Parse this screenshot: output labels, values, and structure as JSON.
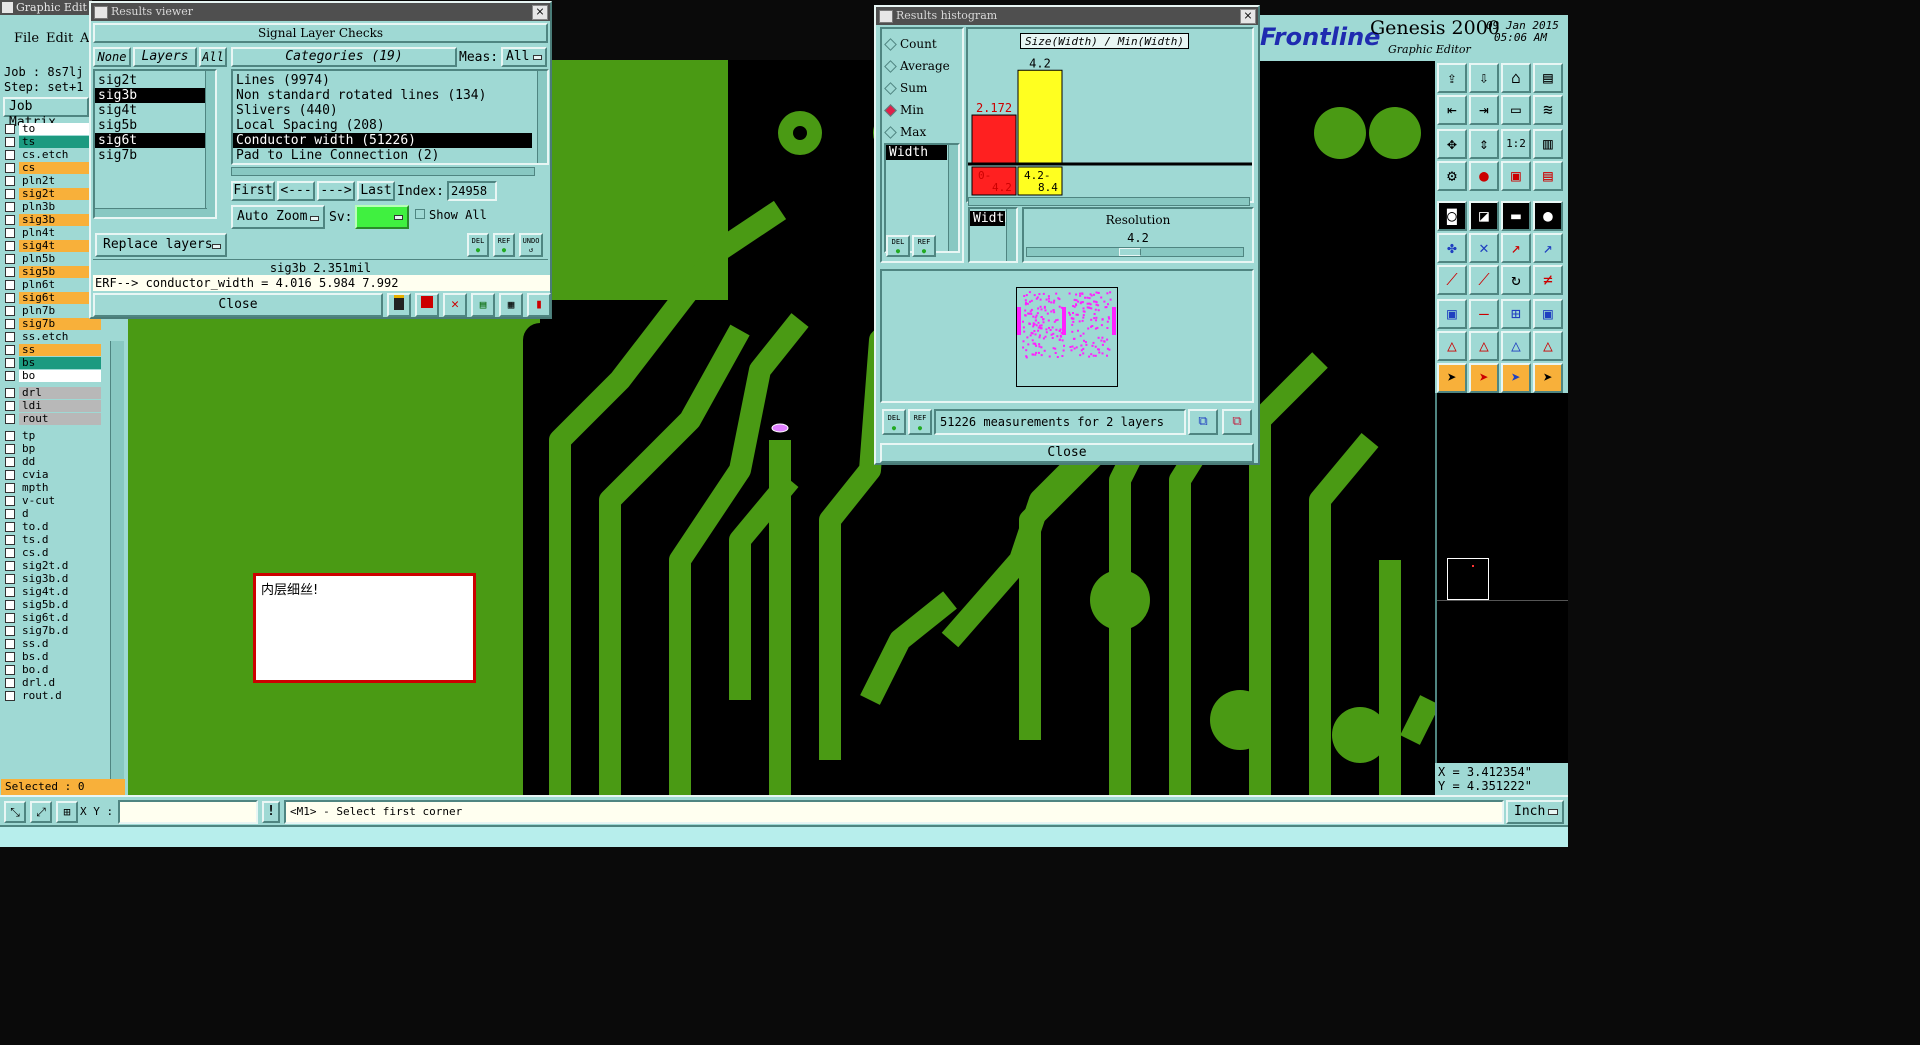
{
  "main_window": {
    "title": "Graphic Edit",
    "menu": [
      "File",
      "Edit",
      "A"
    ],
    "job_label": "Job : 8s7lj",
    "step_label": "Step: set+1",
    "job_matrix": "Job Matrix",
    "layers": [
      {
        "name": "to",
        "color": "#ffffff"
      },
      {
        "name": "ts",
        "color": "#1c9a80"
      },
      {
        "name": "cs.etch",
        "color": "#9fd9d4"
      },
      {
        "name": "cs",
        "color": "#f8b03a"
      },
      {
        "name": "pln2t",
        "color": "#9fd9d4"
      },
      {
        "name": "sig2t",
        "color": "#f8b03a"
      },
      {
        "name": "pln3b",
        "color": "#9fd9d4"
      },
      {
        "name": "sig3b",
        "color": "#f8b03a"
      },
      {
        "name": "pln4t",
        "color": "#9fd9d4"
      },
      {
        "name": "sig4t",
        "color": "#f8b03a"
      },
      {
        "name": "pln5b",
        "color": "#9fd9d4"
      },
      {
        "name": "sig5b",
        "color": "#f8b03a"
      },
      {
        "name": "pln6t",
        "color": "#9fd9d4"
      },
      {
        "name": "sig6t",
        "color": "#f8b03a"
      },
      {
        "name": "pln7b",
        "color": "#9fd9d4"
      },
      {
        "name": "sig7b",
        "color": "#f8b03a"
      },
      {
        "name": "ss.etch",
        "color": "#9fd9d4"
      },
      {
        "name": "ss",
        "color": "#f8b03a"
      },
      {
        "name": "bs",
        "color": "#1c9a80"
      },
      {
        "name": "bo",
        "color": "#ffffff"
      },
      {
        "name": "drl",
        "color": "#b8b8b8"
      },
      {
        "name": "ldi",
        "color": "#b8b8b8"
      },
      {
        "name": "rout",
        "color": "#b8b8b8"
      },
      {
        "name": "tp",
        "color": "#9fd9d4"
      },
      {
        "name": "bp",
        "color": "#9fd9d4"
      },
      {
        "name": "dd",
        "color": "#9fd9d4"
      },
      {
        "name": "cvia",
        "color": "#9fd9d4"
      },
      {
        "name": "mpth",
        "color": "#9fd9d4"
      },
      {
        "name": "v-cut",
        "color": "#9fd9d4"
      },
      {
        "name": "d",
        "color": "#9fd9d4"
      },
      {
        "name": "to.d",
        "color": "#9fd9d4"
      },
      {
        "name": "ts.d",
        "color": "#9fd9d4"
      },
      {
        "name": "cs.d",
        "color": "#9fd9d4"
      },
      {
        "name": "sig2t.d",
        "color": "#9fd9d4"
      },
      {
        "name": "sig3b.d",
        "color": "#9fd9d4"
      },
      {
        "name": "sig4t.d",
        "color": "#9fd9d4"
      },
      {
        "name": "sig5b.d",
        "color": "#9fd9d4"
      },
      {
        "name": "sig6t.d",
        "color": "#9fd9d4"
      },
      {
        "name": "sig7b.d",
        "color": "#9fd9d4"
      },
      {
        "name": "ss.d",
        "color": "#9fd9d4"
      },
      {
        "name": "bs.d",
        "color": "#9fd9d4"
      },
      {
        "name": "bo.d",
        "color": "#9fd9d4"
      },
      {
        "name": "drl.d",
        "color": "#9fd9d4"
      },
      {
        "name": "rout.d",
        "color": "#9fd9d4"
      }
    ],
    "selected": "Selected : 0",
    "xy_label": "X Y :",
    "xy_value": "",
    "prompt": "<M1> - Select first corner",
    "units": "Inch",
    "coord_x": "X = 3.412354\"",
    "coord_y": "Y = 4.351222\""
  },
  "brand": {
    "logo": "Frontline",
    "product": "Genesis 2000",
    "subtitle": "Graphic Editor",
    "date": "09 Jan 2015",
    "time": "05:06 AM"
  },
  "results_viewer": {
    "title": "Results viewer",
    "heading": "Signal Layer Checks",
    "none_btn": "None",
    "layers_btn": "Layers",
    "all_btn": "All",
    "layers": [
      "sig2t",
      "sig3b",
      "sig4t",
      "sig5b",
      "sig6t",
      "sig7b"
    ],
    "categories_label": "Categories (19)",
    "meas_label": "Meas:",
    "meas_value": "All",
    "categories": [
      "Lines (9974)",
      "Non standard rotated lines (134)",
      "Slivers (440)",
      "Local Spacing (208)",
      "Conductor width (51226)",
      "Pad to Line Connection (2)"
    ],
    "first": "First",
    "prev": "<---",
    "next": "--->",
    "last": "Last",
    "index_label": "Index:",
    "index_value": "24958",
    "auto_zoom": "Auto Zoom",
    "sv_label": "Sv:",
    "show_all": "Show All",
    "replace_layers": "Replace layers",
    "del": "DEL",
    "ref": "REF",
    "undo": "UNDO",
    "status": "sig3b 2.351mil",
    "erf": "ERF--> conductor_width = 4.016 5.984 7.992",
    "close": "Close"
  },
  "histogram": {
    "title": "Results histogram",
    "options": [
      "Count",
      "Average",
      "Sum",
      "Min",
      "Max"
    ],
    "selected_option": "Min",
    "list_item": "Width",
    "chart_title": "Size(Width) / Min(Width)",
    "resolution_label": "Resolution",
    "resolution_value": "4.2",
    "list2_item": "Width",
    "del": "DEL",
    "ref": "REF",
    "measurements": "51226 measurements for 2 layers",
    "close": "Close"
  },
  "chart_data": {
    "type": "bar",
    "title": "Size(Width) / Min(Width)",
    "categories": [
      "0-4.2",
      "4.2-8.4"
    ],
    "values": [
      2.172,
      4.2
    ],
    "colors": [
      "#ff2020",
      "#ffff20"
    ],
    "ylim": [
      0,
      4.8
    ]
  },
  "note": {
    "text": "内层细丝!"
  }
}
